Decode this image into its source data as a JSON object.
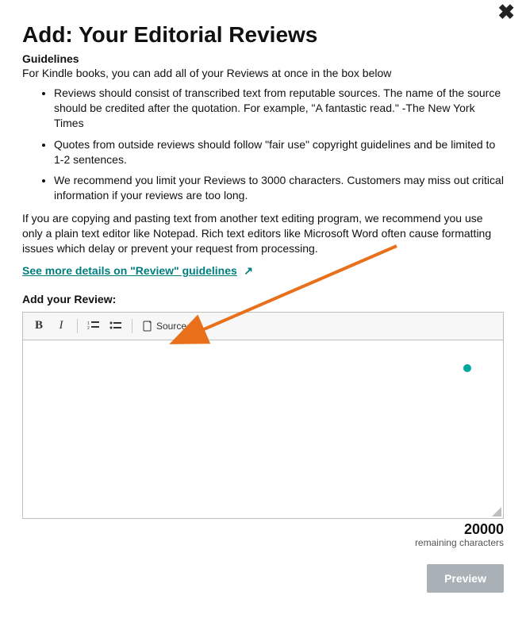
{
  "title": "Add: Your Editorial Reviews",
  "guidelines_heading": "Guidelines",
  "intro_text": "For Kindle books, you can add all of your Reviews at once in the box below",
  "bullets": [
    "Reviews should consist of transcribed text from reputable sources. The name of the source should be credited after the quotation. For example, \"A fantastic read.\" -The New York Times",
    "Quotes from outside reviews should follow \"fair use\" copyright guidelines and be limited to 1-2 sentences.",
    "We recommend you limit your Reviews to 3000 characters. Customers may miss out critical information if your reviews are too long."
  ],
  "copy_paragraph": "If you are copying and pasting text from another text editing program, we recommend you use only a plain text editor like Notepad. Rich text editors like Microsoft Word often cause formatting issues which delay or prevent your request from processing.",
  "details_link": "See more details on \"Review\" guidelines",
  "add_label": "Add your Review:",
  "toolbar": {
    "bold": "B",
    "italic": "I",
    "source_label": "Source"
  },
  "char_count": "20000",
  "char_label": "remaining characters",
  "preview_label": "Preview"
}
